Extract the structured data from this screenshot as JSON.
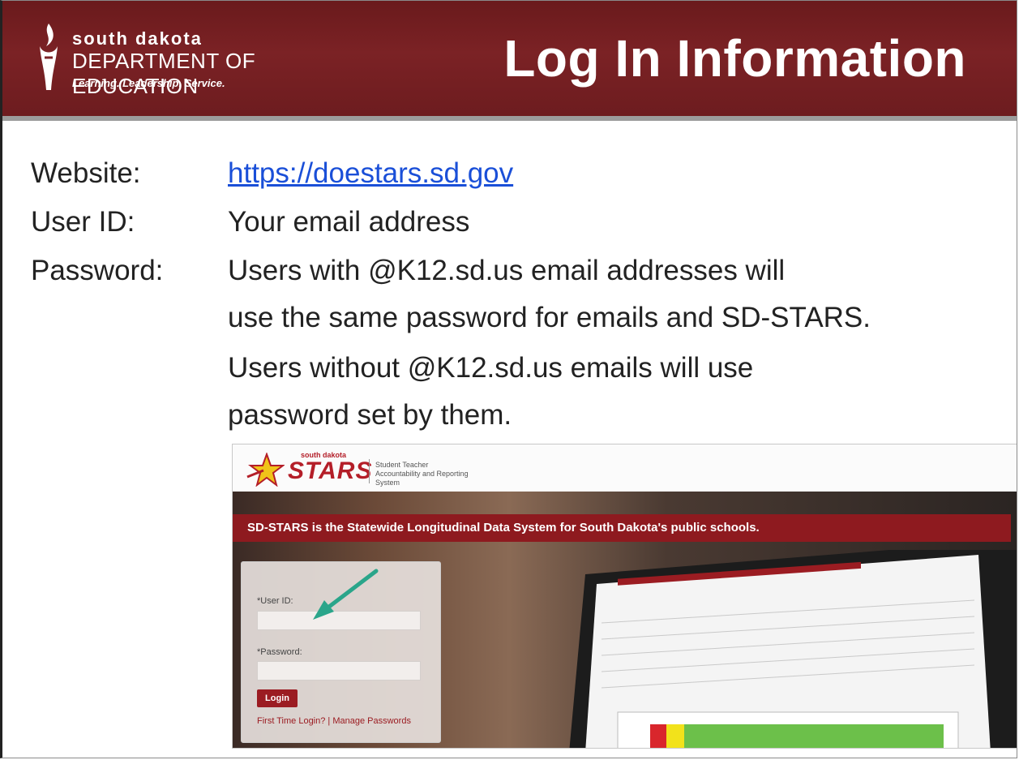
{
  "header": {
    "logo_line1": "south dakota",
    "logo_line2": "DEPARTMENT OF EDUCATION",
    "logo_tagline": "Learning. Leadership. Service.",
    "title": "Log In Information"
  },
  "info": {
    "website_label": "Website:",
    "website_value": "https://doestars.sd.gov",
    "userid_label": "User ID:",
    "userid_value": "Your email address",
    "password_label": "Password:",
    "password_lines": [
      "Users with @K12.sd.us email addresses will",
      "use the same password for emails and SD-STARS.",
      "Users without @K12.sd.us emails will use",
      "password set by them."
    ]
  },
  "screenshot": {
    "logo_small": "south dakota",
    "logo_word": "STARS",
    "logo_sub": "Student Teacher Accountability and Reporting System",
    "banner": "SD-STARS is the Statewide Longitudinal Data System for South Dakota's public schools.",
    "userid_label": "*User ID:",
    "password_label": "*Password:",
    "login_button": "Login",
    "links": "First Time Login? | Manage Passwords"
  },
  "colors": {
    "header_bg": "#7b2225",
    "link": "#1a4fd8",
    "banner_bg": "#8e1a1f",
    "arrow": "#2aa58a"
  },
  "icons": [
    "torch-logo-icon",
    "star-logo-icon",
    "arrow-pointer-icon"
  ]
}
